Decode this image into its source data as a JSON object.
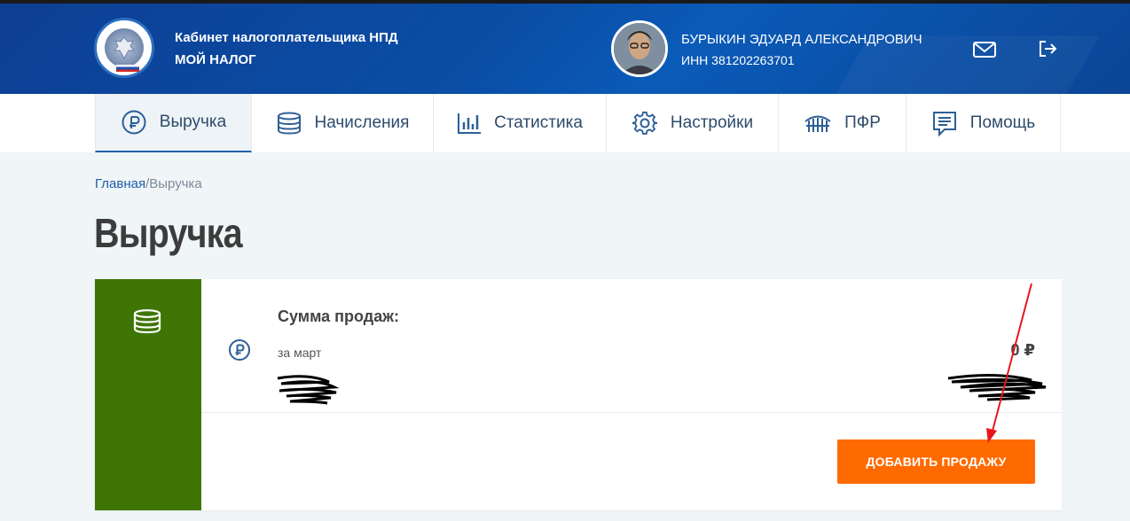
{
  "header": {
    "app_line1": "Кабинет налогоплательщика НПД",
    "app_line2": "МОЙ НАЛОГ",
    "user_name": "БУРЫКИН ЭДУАРД АЛЕКСАНДРОВИЧ",
    "user_inn": "ИНН 381202263701",
    "icons": [
      "mail-icon",
      "logout-icon"
    ]
  },
  "nav": {
    "items": [
      {
        "label": "Выручка",
        "icon": "ruble-icon",
        "active": true
      },
      {
        "label": "Начисления",
        "icon": "coins-icon"
      },
      {
        "label": "Статистика",
        "icon": "bar-chart-icon"
      },
      {
        "label": "Настройки",
        "icon": "gear-icon"
      },
      {
        "label": "ПФР",
        "icon": "pfr-icon"
      },
      {
        "label": "Помощь",
        "icon": "chat-icon"
      }
    ]
  },
  "breadcrumb": {
    "home": "Главная",
    "separator": "/",
    "current": "Выручка"
  },
  "page": {
    "title": "Выручка"
  },
  "card": {
    "sum_title": "Сумма продаж:",
    "period": "за март",
    "amount": "0 ₽",
    "add_button_label": "ДОБАВИТЬ ПРОДАЖУ"
  },
  "colors": {
    "header_blue": "#0a4ea6",
    "accent_green": "#3f7505",
    "button_orange": "#ff6a00",
    "annotation_red": "#e8161b"
  }
}
